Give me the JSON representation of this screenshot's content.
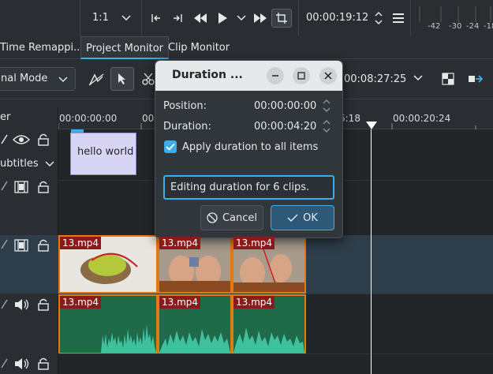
{
  "monitor_toolbar": {
    "zoom_value": "1:1",
    "timecode": "00:00:19:12",
    "vu_labels": [
      "-42",
      "-30",
      "-24",
      "-18"
    ]
  },
  "tabs": [
    {
      "label": "Time Remappi..."
    },
    {
      "label": "Project Monitor"
    },
    {
      "label": "Clip Monitor"
    }
  ],
  "timeline_toolbar": {
    "mode_value": "nal Mode",
    "timecode": "00:08:27:25"
  },
  "ruler": {
    "ticks": [
      "00:00:00:00",
      "00",
      "6:18",
      "00:00:20:24"
    ]
  },
  "track_headers": {
    "top_label": "er",
    "subtitles_label": "ubtitles"
  },
  "subtitle_clip": {
    "text": "hello world"
  },
  "video_clips": [
    {
      "name": "13.mp4"
    },
    {
      "name": "13.mp4"
    },
    {
      "name": "13.mp4"
    }
  ],
  "audio_clips": [
    {
      "name": "13.mp4"
    },
    {
      "name": "13.mp4"
    },
    {
      "name": "13.mp4"
    }
  ],
  "dialog": {
    "title": "Duration ...",
    "position_label": "Position:",
    "position_value": "00:00:00:00",
    "duration_label": "Duration:",
    "duration_value": "00:00:04:20",
    "checkbox_label": "Apply duration to all items",
    "checkbox_checked": true,
    "message": "Editing duration for 6 clips.",
    "cancel_label": "Cancel",
    "ok_label": "OK"
  },
  "colors": {
    "accent": "#3daee9",
    "clip_border": "#e07b14",
    "clip_tag": "#8b1a1a",
    "audio_clip": "#1f6a49",
    "waveform": "#3fc1a0",
    "subtitle_clip": "#d8d4f4"
  }
}
